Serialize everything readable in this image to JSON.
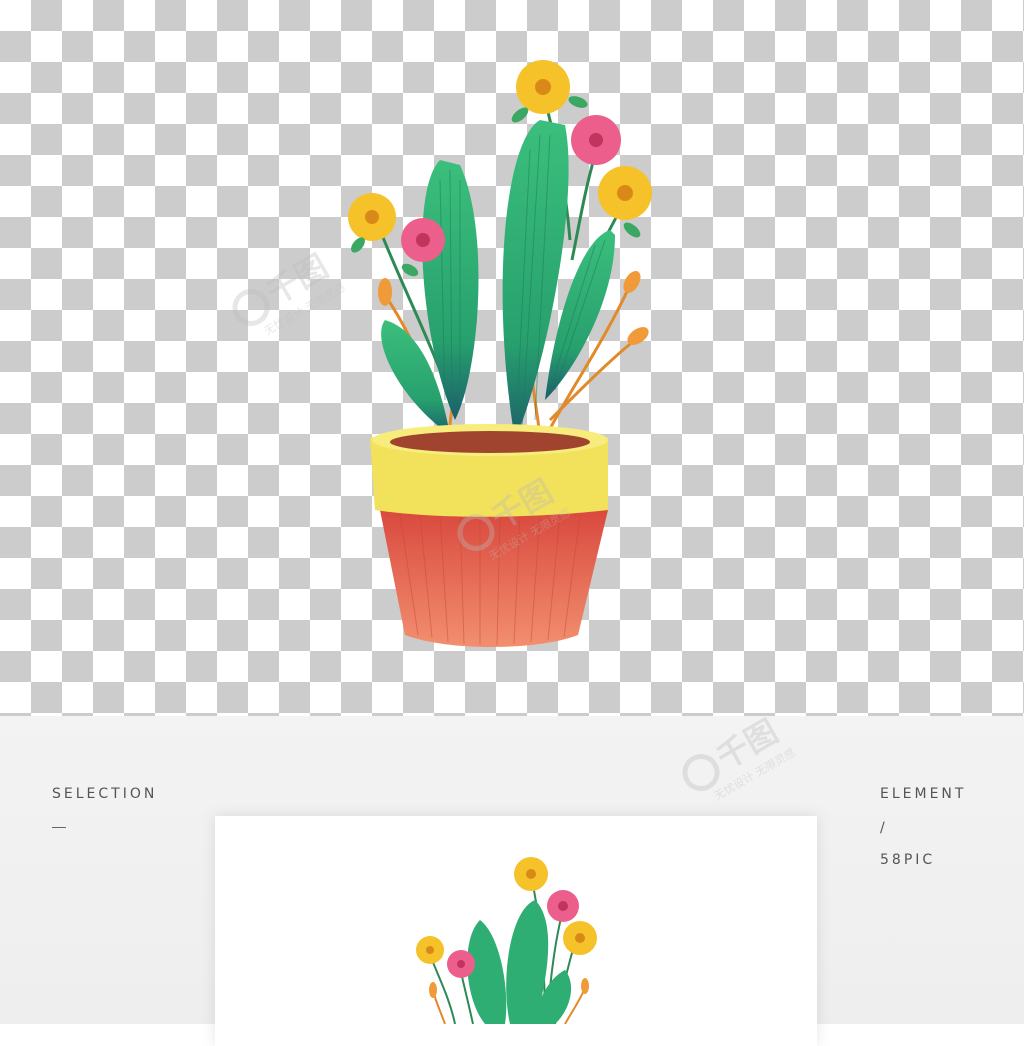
{
  "labels": {
    "left_title": "SELECTION",
    "right_title": "ELEMENT",
    "right_slash": "/",
    "right_sub": "58PIC"
  },
  "watermark": {
    "brand": "千图",
    "slogan": "无忧设计 无限灵感"
  },
  "colors": {
    "leaf": "#2fae73",
    "leaf_dark": "#1b6b5a",
    "flower_yellow": "#f6c22a",
    "flower_pink": "#ec5f8d",
    "pot_rim": "#f2e15a",
    "pot_body": "#e8624e",
    "stem_orange": "#e8932e"
  }
}
